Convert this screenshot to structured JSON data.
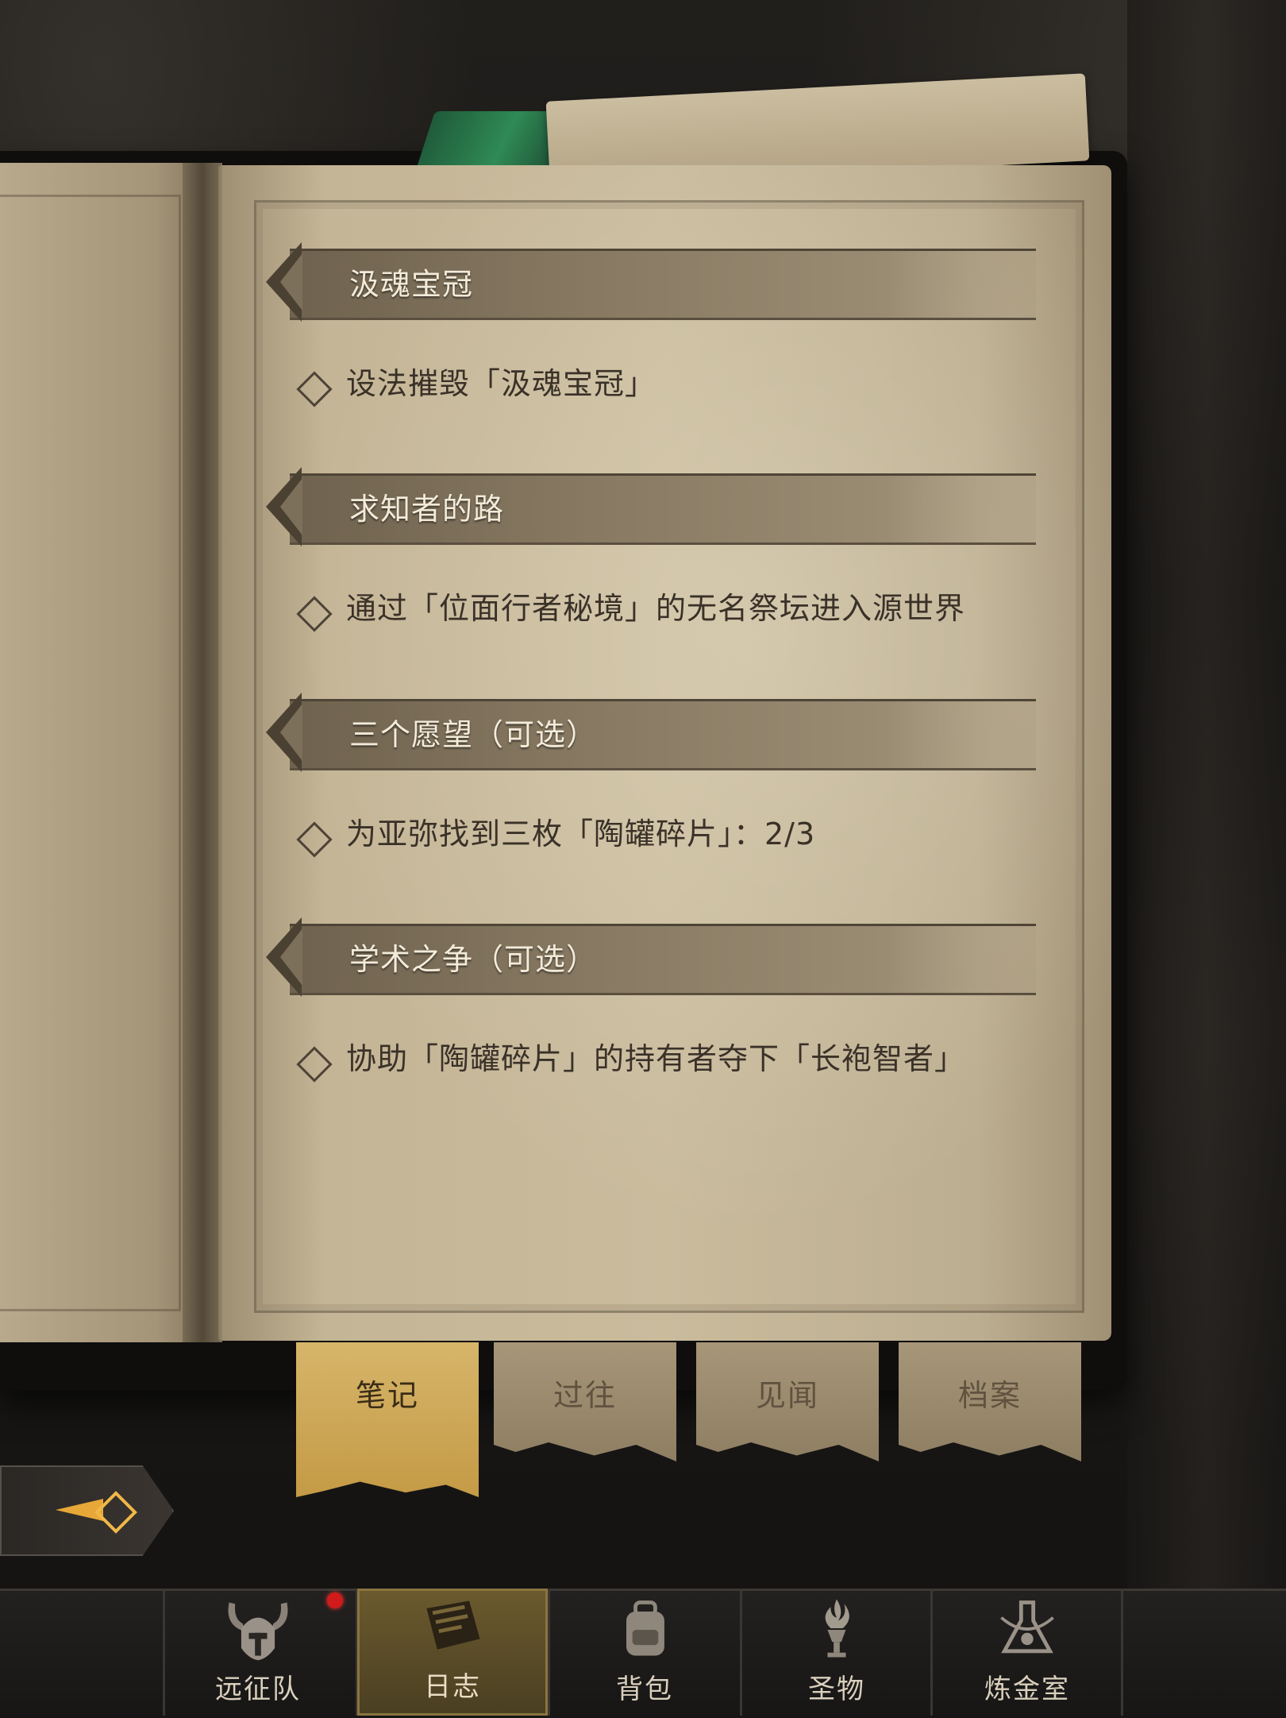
{
  "quests": [
    {
      "title": "汲魂宝冠",
      "objective": "设法摧毁「汲魂宝冠」"
    },
    {
      "title": "求知者的路",
      "objective": "通过「位面行者秘境」的无名祭坛进入源世界"
    },
    {
      "title": "三个愿望（可选）",
      "objective": "为亚弥找到三枚「陶罐碎片」：2/3"
    },
    {
      "title": "学术之争（可选）",
      "objective": "协助「陶罐碎片」的持有者夺下「长袍智者」"
    }
  ],
  "tabs": [
    {
      "label": "笔记",
      "active": true
    },
    {
      "label": "过往",
      "active": false
    },
    {
      "label": "见闻",
      "active": false
    },
    {
      "label": "档案",
      "active": false
    }
  ],
  "nav": [
    {
      "label": "远征队",
      "icon": "horned-helmet-icon",
      "active": false,
      "badge": true
    },
    {
      "label": "日志",
      "icon": "journal-icon",
      "active": true
    },
    {
      "label": "背包",
      "icon": "backpack-icon",
      "active": false
    },
    {
      "label": "圣物",
      "icon": "torch-relic-icon",
      "active": false
    },
    {
      "label": "炼金室",
      "icon": "alchemy-icon",
      "active": false
    }
  ],
  "colors": {
    "accent": "#e8a838",
    "active_tab": "#c9a450",
    "parchment": "#c4b596",
    "badge": "#d11a1a"
  }
}
